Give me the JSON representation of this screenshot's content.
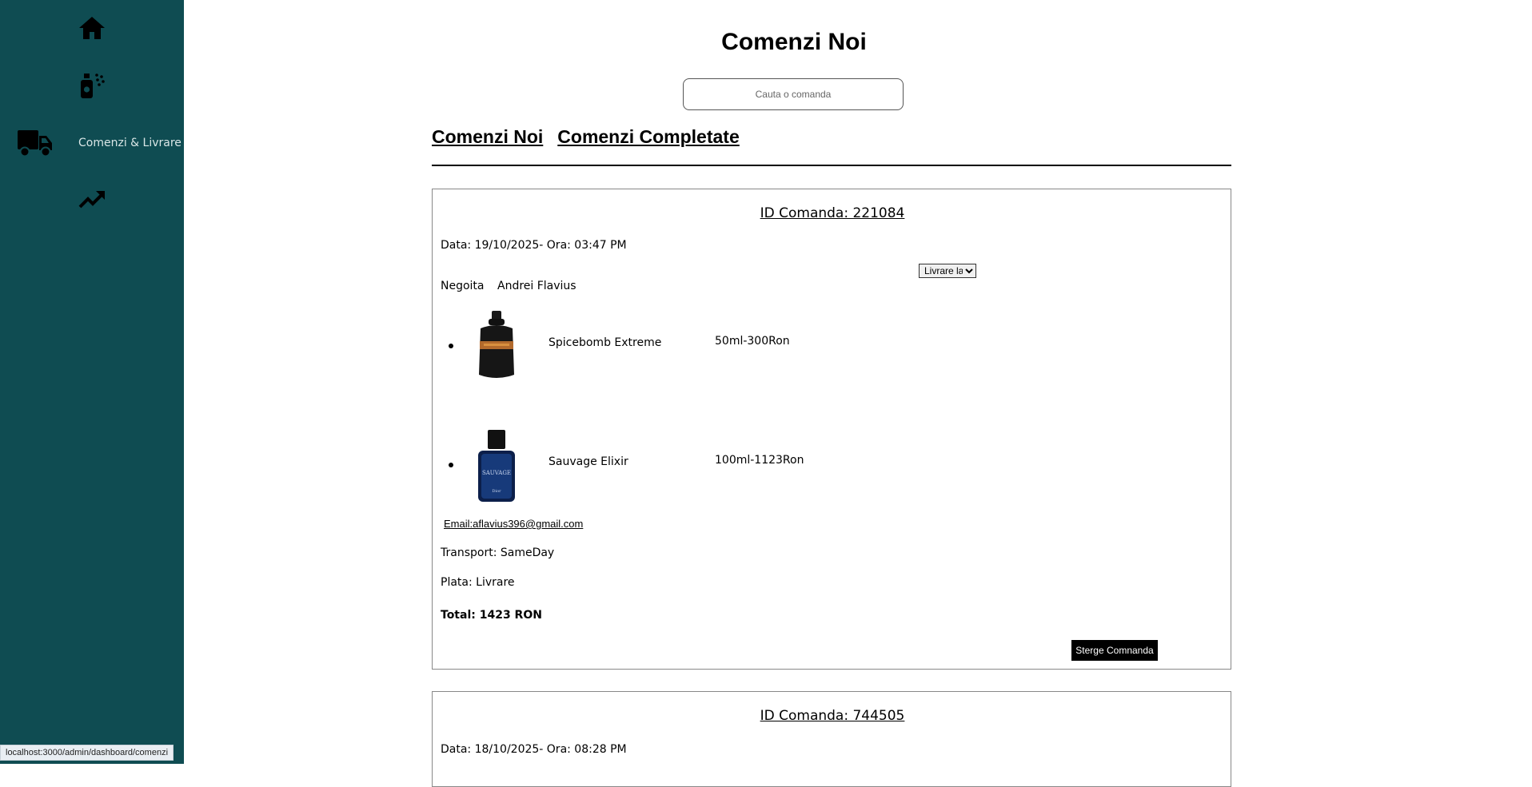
{
  "sidebar": {
    "items": [
      {
        "icon": "home-icon",
        "label": ""
      },
      {
        "icon": "perfume-spray-icon",
        "label": ""
      },
      {
        "icon": "truck-icon",
        "label": "Comenzi & Livrare"
      },
      {
        "icon": "trending-up-icon",
        "label": ""
      }
    ]
  },
  "header": {
    "title": "Comenzi Noi",
    "search_placeholder": "Cauta o comanda"
  },
  "tabs": [
    {
      "label": "Comenzi Noi"
    },
    {
      "label": "Comenzi Completate"
    }
  ],
  "orders": [
    {
      "id_label": "ID Comanda: 221084",
      "datetime": "Data: 19/10/2025- Ora: 03:47 PM",
      "status_selected": "Livrare la",
      "last_name": "Negoita",
      "first_name": "Andrei Flavius",
      "products": [
        {
          "name": "Spicebomb Extreme",
          "variant": "50ml-300Ron"
        },
        {
          "name": "Sauvage Elixir",
          "variant": "100ml-1123Ron"
        }
      ],
      "email": "Email:aflavius396@gmail.com",
      "transport": "Transport: SameDay",
      "payment": "Plata: Livrare",
      "total": "Total: 1423 RON",
      "delete_label": "Sterge Comnanda"
    },
    {
      "id_label": "ID Comanda: 744505",
      "datetime": "Data: 18/10/2025- Ora: 08:28 PM"
    }
  ],
  "status_bar": {
    "url": "localhost:3000/admin/dashboard/comenzi"
  },
  "colors": {
    "sidebar_bg": "#0f4c52",
    "sidebar_text": "#d9e6e6",
    "button_bg": "#000000"
  }
}
